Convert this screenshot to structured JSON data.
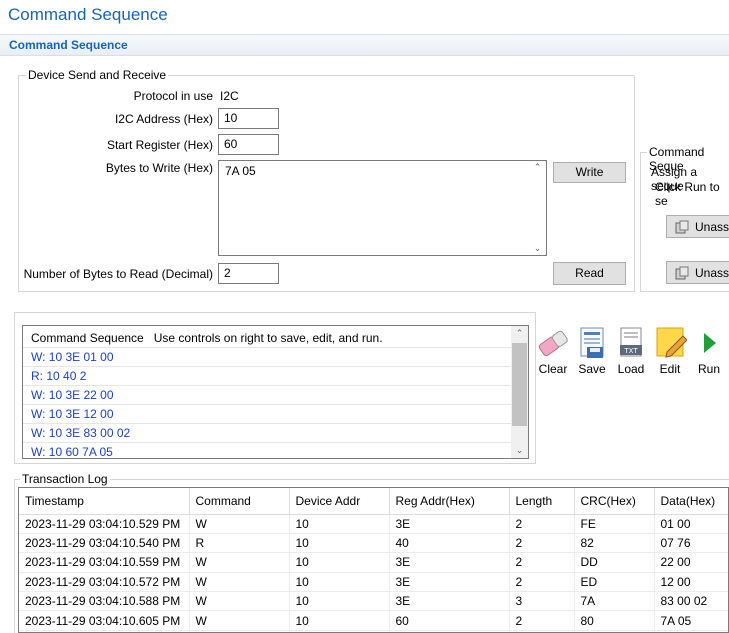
{
  "window": {
    "title": "Command Sequence",
    "subtitle": "Command Sequence"
  },
  "device": {
    "legend": "Device Send and Receive",
    "protocol_label": "Protocol in use",
    "protocol_value": "I2C",
    "i2c_label": "I2C Address (Hex)",
    "i2c_value": "10",
    "start_label": "Start Register (Hex)",
    "start_value": "60",
    "bytes_write_label": "Bytes to Write (Hex)",
    "bytes_write_value": "7A 05",
    "write_button": "Write",
    "read_count_label": "Number of Bytes to Read (Decimal)",
    "read_count_value": "2",
    "read_button": "Read"
  },
  "side_panel": {
    "legend": "Command Seque",
    "line1": "Assign a seque",
    "line2": "Click Run to se",
    "button1": "Unassi",
    "button2": "Unassi"
  },
  "sequence": {
    "header_title": "Command Sequence",
    "header_hint": "Use controls on right to save, edit, and run.",
    "items": [
      "W: 10 3E 01 00",
      "R: 10 40 2",
      "W: 10 3E 22 00",
      "W: 10 3E 12 00",
      "W: 10 3E 83 00 02",
      "W: 10 60 7A 05"
    ]
  },
  "toolbar": {
    "clear": "Clear",
    "save": "Save",
    "load": "Load",
    "edit": "Edit",
    "run": "Run",
    "load_badge": "TXT"
  },
  "log": {
    "legend": "Transaction Log",
    "columns": [
      "Timestamp",
      "Command",
      "Device Addr",
      "Reg Addr(Hex)",
      "Length",
      "CRC(Hex)",
      "Data(Hex)"
    ],
    "rows": [
      [
        "2023-11-29 03:04:10.529 PM",
        "W",
        "10",
        "3E",
        "2",
        "FE",
        "01 00"
      ],
      [
        "2023-11-29 03:04:10.540 PM",
        "R",
        "10",
        "40",
        "2",
        "82",
        "07 76"
      ],
      [
        "2023-11-29 03:04:10.559 PM",
        "W",
        "10",
        "3E",
        "2",
        "DD",
        "22 00"
      ],
      [
        "2023-11-29 03:04:10.572 PM",
        "W",
        "10",
        "3E",
        "2",
        "ED",
        "12 00"
      ],
      [
        "2023-11-29 03:04:10.588 PM",
        "W",
        "10",
        "3E",
        "3",
        "7A",
        "83 00 02"
      ],
      [
        "2023-11-29 03:04:10.605 PM",
        "W",
        "10",
        "60",
        "2",
        "80",
        "7A 05"
      ]
    ]
  },
  "colors": {
    "title_blue": "#1565b8",
    "sequence_text": "#1a3fd0",
    "run_green": "#1f9e3a"
  }
}
